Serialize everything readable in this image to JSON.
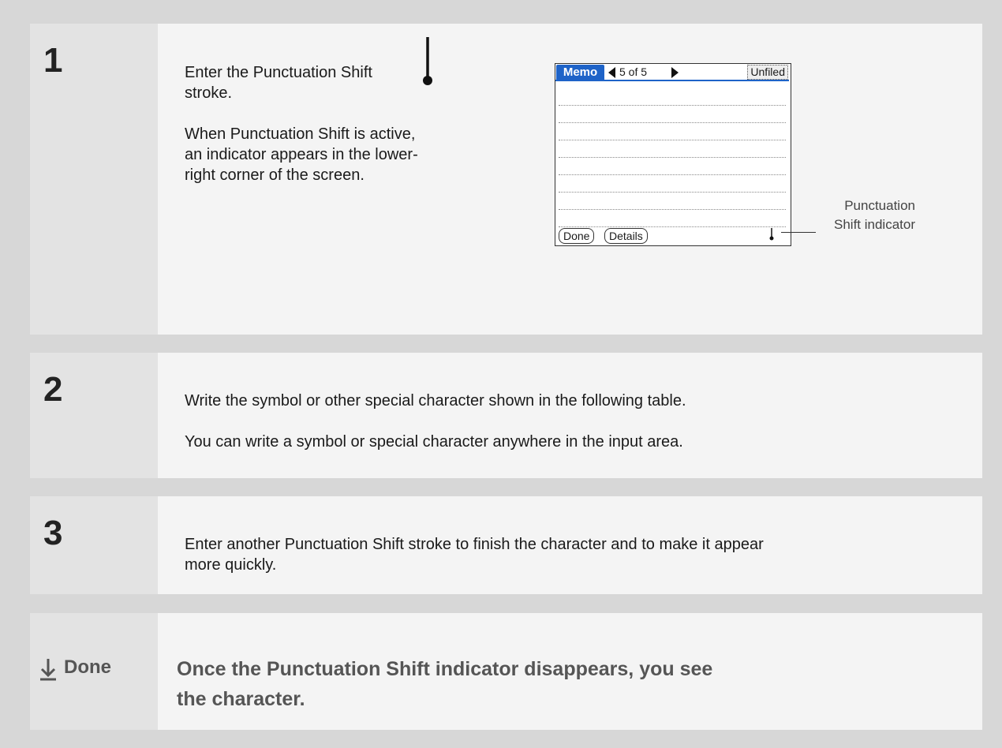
{
  "step1": {
    "number": "1",
    "line1": "Enter the Punctuation Shift",
    "line2": "stroke.",
    "para2": "When Punctuation Shift is active, an indicator appears in the lower-right corner of the screen.",
    "screen": {
      "app_tab": "Memo",
      "page_count": "5 of 5",
      "category": "Unfiled",
      "done_button": "Done",
      "details_button": "Details"
    },
    "callout": "Punctuation Shift indicator"
  },
  "step2": {
    "number": "2",
    "para1": "Write the symbol or other special character shown in the following table.",
    "para2": "You can write a symbol or special character anywhere in the input area."
  },
  "step3": {
    "number": "3",
    "para1": "Enter another Punctuation Shift stroke to finish the character and to make it appear more quickly."
  },
  "done": {
    "label": "Done",
    "text": "Once the Punctuation Shift indicator disappears, you see the character."
  }
}
